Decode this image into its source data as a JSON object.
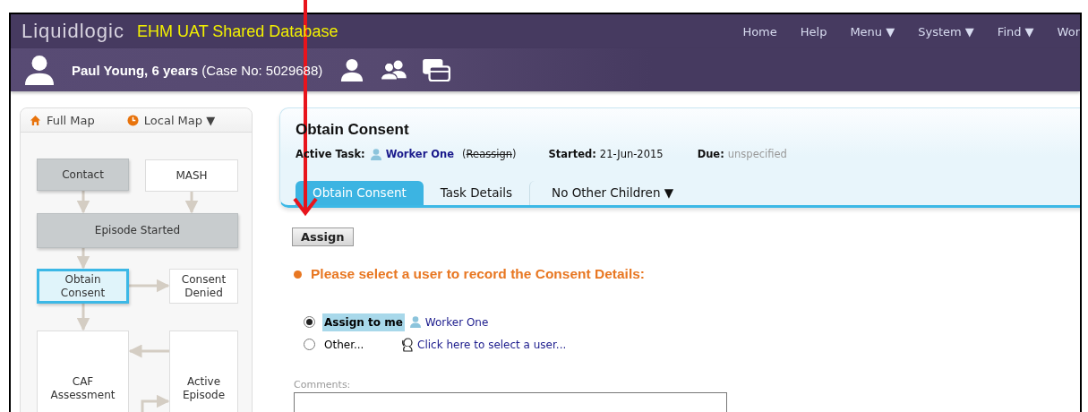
{
  "app": {
    "logo": "Liquidlogic",
    "database": "EHM UAT Shared Database"
  },
  "nav": [
    "Home",
    "Help",
    "Menu ▼",
    "System ▼",
    "Find ▼",
    "Wor"
  ],
  "case_bar": {
    "name": "Paul Young, 6 years",
    "case_no": "(Case No: 5029688)"
  },
  "map_tabs": [
    {
      "label": "Full Map",
      "kind": "home"
    },
    {
      "label": "Local Map ▼",
      "kind": "clock"
    }
  ],
  "flow_nodes": [
    {
      "label": "Contact",
      "kind": "done"
    },
    {
      "label": "MASH",
      "kind": "pending"
    },
    {
      "label": "Episode Started",
      "kind": "done"
    },
    {
      "label": "Obtain Consent",
      "kind": "current"
    },
    {
      "label": "Consent Denied",
      "kind": "pending"
    },
    {
      "label": "CAF Assessment",
      "kind": "pending"
    },
    {
      "label": "Active Episode",
      "kind": "pending"
    }
  ],
  "task": {
    "title": "Obtain Consent",
    "active_task_label": "Active Task:",
    "worker": "Worker One",
    "reassign_brackets": [
      "(",
      ")"
    ],
    "reassign": {
      "text": "Reassign",
      "disabled": true
    },
    "started_label": "Started:",
    "started": "21-Jun-2015",
    "due_label": "Due:",
    "due": "unspecified"
  },
  "tabs": [
    {
      "label": "Obtain Consent",
      "selected": true
    },
    {
      "label": "Task Details",
      "selected": false
    },
    {
      "label": "No Other Children ▼",
      "selected": false
    }
  ],
  "assign_button": "Assign",
  "prompt": "Please select a user to record the Consent Details:",
  "options": [
    {
      "label": "Assign to me",
      "selected": true,
      "kind": "me",
      "user": "Worker One"
    },
    {
      "label": "Other...",
      "selected": false,
      "kind": "other",
      "user": "Click here to select a user..."
    }
  ],
  "comments": {
    "label": "Comments:"
  }
}
